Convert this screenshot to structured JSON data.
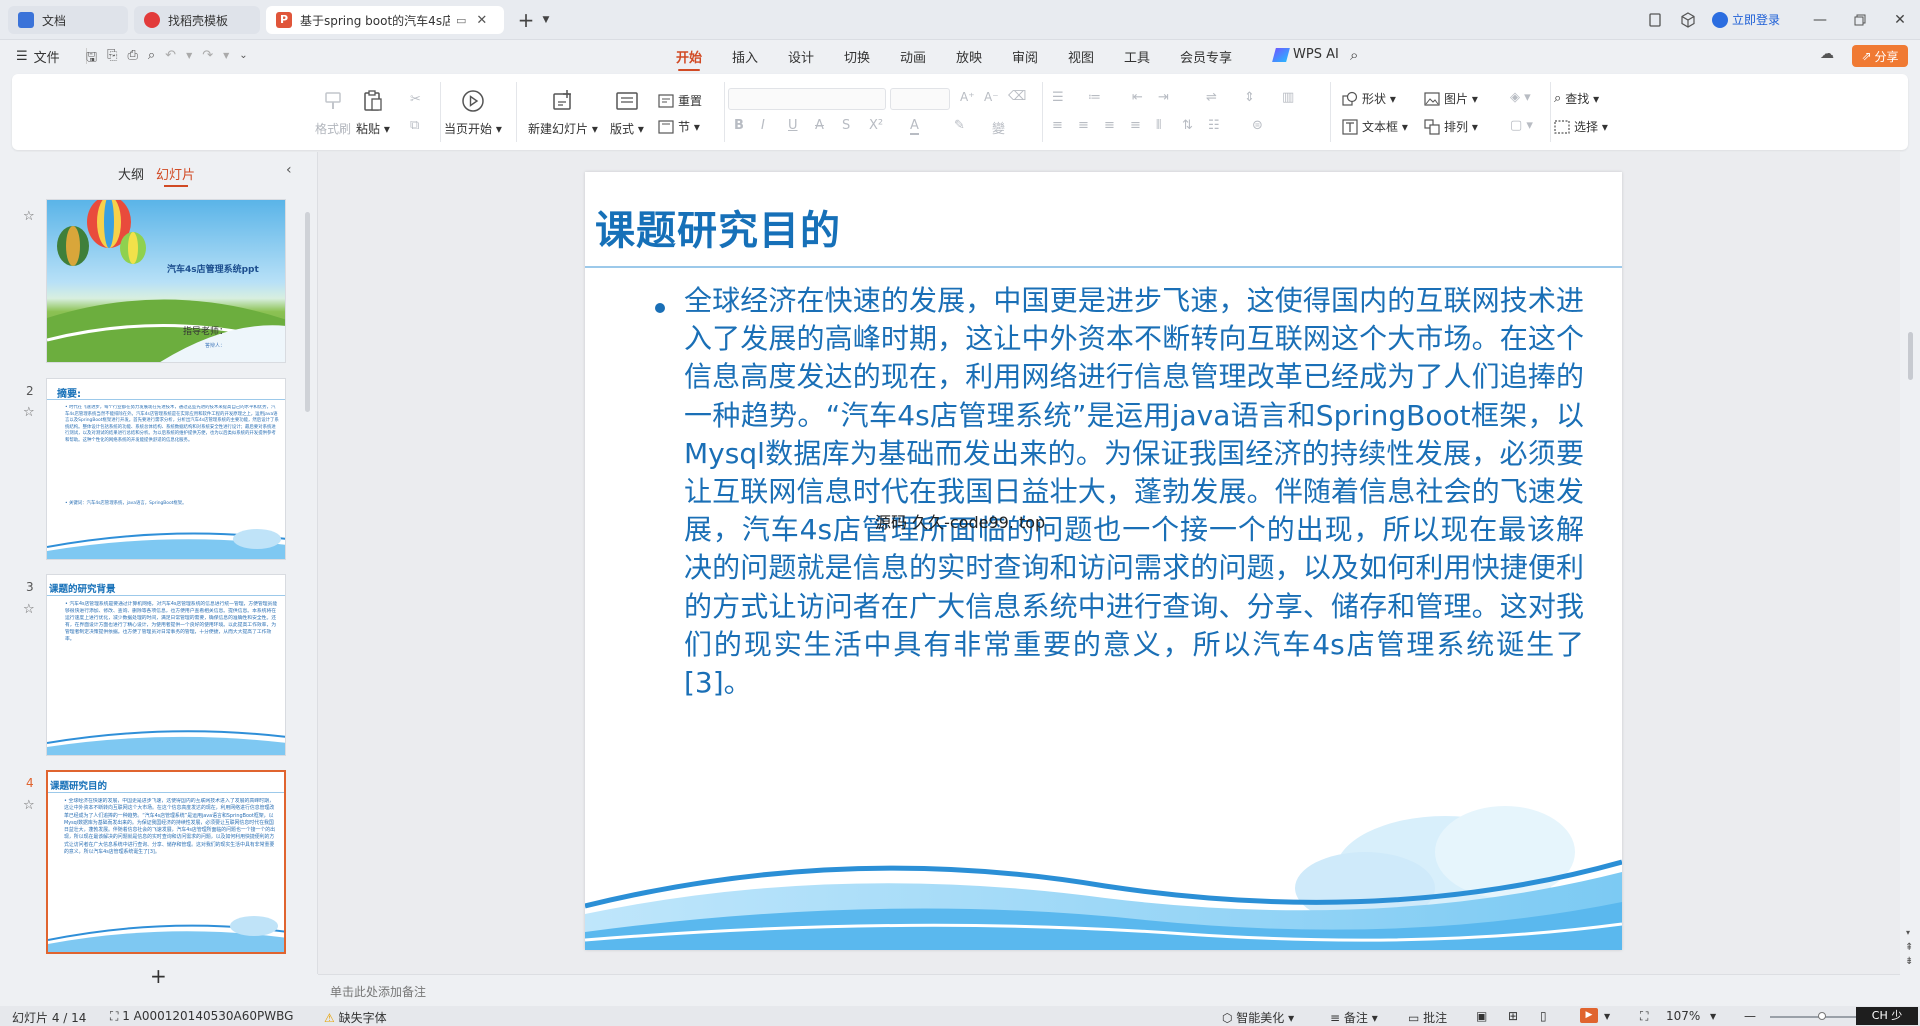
{
  "titlebar": {
    "tabs": [
      {
        "label": "文档",
        "color": "#3b73d9"
      },
      {
        "label": "找稻壳模板",
        "color": "#e23b3b"
      },
      {
        "label": "基于spring boot的汽车4s店",
        "color": "#e0553a"
      }
    ],
    "login_label": "立即登录"
  },
  "menubar": {
    "file_label": "文件",
    "tabs": [
      "开始",
      "插入",
      "设计",
      "切换",
      "动画",
      "放映",
      "审阅",
      "视图",
      "工具",
      "会员专享"
    ],
    "active_tab": "开始",
    "wps_ai_label": "WPS AI",
    "share_label": "分享"
  },
  "ribbon": {
    "format_painter": "格式刷",
    "paste": "粘贴",
    "from_current": "当页开始",
    "new_slide": "新建幻灯片",
    "layout": "版式",
    "reset": "重置",
    "section": "节",
    "shape": "形状",
    "picture": "图片",
    "textbox": "文本框",
    "arrange": "排列",
    "find": "查找",
    "select": "选择"
  },
  "leftpanel": {
    "tab_outline": "大纲",
    "tab_slides": "幻灯片",
    "active_tab": "幻灯片",
    "slides": [
      {
        "num": "",
        "title": "汽车4s店管理系统ppt",
        "subtitle": "指导老师：",
        "author": "答辩人："
      },
      {
        "num": "2",
        "title": "摘要:",
        "body": "• 时代在飞速进步，每个行业都在努力发展现在先进技术，通过这些先进的技术来提高自己的水平和优势，汽车4s店管理系统当然不能排除在外。汽车4s店管理系统是在实际应用和软件工程的开发原理之上，运用java语言以及SpringBoot框架进行开发。首先要进行需求分析，分析出汽车4s店管理系统的主要功能，然后设计了系统结构。整体设计包括系统的功能、系统总体结构、系统数据结构和对系统安全性进行设计；最后要对系统进行测试，以及对测试的结果进行总结和分析。为以后系统的维护提供方便，也为以后类似系统的开发提供参考和帮助。这种个性化的网络系统的开发能提供舒适的信息化服务。",
        "keywords": "• 关键词：汽车4s店管理系统，java语言，SpringBoot框架。"
      },
      {
        "num": "3",
        "title": "课题的研究背景",
        "body": "• 汽车4s店管理系统是要通过计算机网络，对汽车4s店管理系统的信息进行统一管理，方便管理员能够很快进行添加、修改、查询、删除等各项信息，也方便用户查看相关信息。提供信息。本系统将在运行速度上进行优化，减少数据处理的时间，满足日常管理的需要，确保信息的准确性和安全性。还有，在界面设计方面也进行了精心设计，为使用者提供一个良好的使用环境。以此提高工作效率，为管理者制定决策提供依据。也方便了管理员对日常事务的管理，十分便捷，从而大大提高了工作效率。"
      },
      {
        "num": "4",
        "title": "课题研究目的",
        "body": "• 全球经济在快速的发展，中国更是进步飞速，这使得国内的互联网技术进入了发展的高峰时期，这让中外资本不断转向互联网这个大市场。在这个信息高度发达的现在，利用网络进行信息管理改革已经成为了人们追捧的一种趋势。“汽车4s店管理系统”是运用java语言和SpringBoot框架，以Mysql数据库为基础而发出来的。为保证我国经济的持续性发展，必须要让互联网信息时代在我国日益壮大，蓬勃发展。伴随着信息社会的飞速发展，汽车4s店管理所面临的问题也一个接一个的出现，所以现在最该解决的问题就是信息的实时查询和访问需求的问题，以及如何利用快捷便利的方式让访问者在广大信息系统中进行查询、分享、储存和管理。这对我们的现实生活中具有非常重要的意义，所以汽车4s店管理系统诞生了[3]。"
      }
    ],
    "add_label": "+"
  },
  "slide": {
    "title": "课题研究目的",
    "body": "全球经济在快速的发展，中国更是进步飞速，这使得国内的互联网技术进入了发展的高峰时期，这让中外资本不断转向互联网这个大市场。在这个信息高度发达的现在，利用网络进行信息管理改革已经成为了人们追捧的一种趋势。“汽车4s店管理系统”是运用java语言和SpringBoot框架，以Mysql数据库为基础而发出来的。为保证我国经济的持续性发展，必须要让互联网信息时代在我国日益壮大，蓬勃发展。伴随着信息社会的飞速发展，汽车4s店管理所面临的问题也一个接一个的出现，所以现在最该解决的问题就是信息的实时查询和访问需求的问题，以及如何利用快捷便利的方式让访问者在广大信息系统中进行查询、分享、储存和管理。这对我们的现实生活中具有非常重要的意义，所以汽车4s店管理系统诞生了[3]。",
    "watermark": "源码 久久-code99. top"
  },
  "notes": {
    "placeholder": "单击此处添加备注"
  },
  "status": {
    "slide_count": "幻灯片 4 / 14",
    "theme": "1 A000120140530A60PWBG",
    "missing_font": "缺失字体",
    "smart_beautify": "智能美化",
    "notes": "备注",
    "comments": "批注",
    "zoom": "107%",
    "ime": "CH 少"
  },
  "colors": {
    "accent": "#d14a24",
    "slide_title": "#1670b8",
    "slide_text": "#1a6fb6"
  }
}
